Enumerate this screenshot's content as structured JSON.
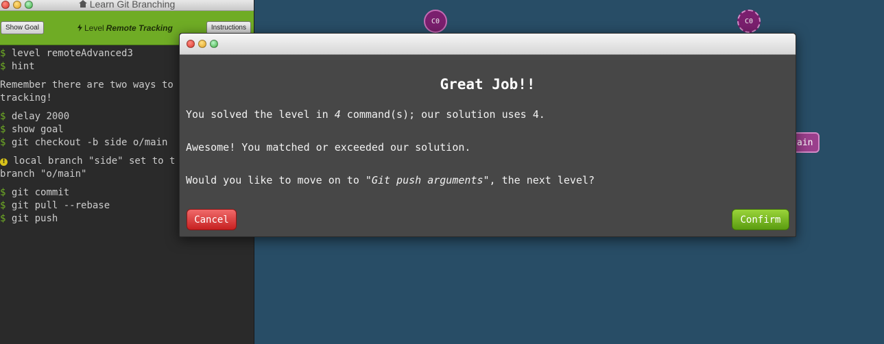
{
  "viz": {
    "commit_left": "C0",
    "commit_right": "C0",
    "branch_partial": "ain"
  },
  "terminal": {
    "window_title": "Learn Git Branching",
    "show_goal_label": "Show Goal",
    "level_prefix": "Level",
    "level_name": "Remote Tracking",
    "instructions_label": "Instructions",
    "lines": [
      {
        "prompt": "$",
        "text": " level remoteAdvanced3"
      },
      {
        "prompt": "$",
        "text": " hint"
      },
      {
        "prompt": "",
        "text": "Remember there are two ways to"
      },
      {
        "prompt": "",
        "text": "tracking!"
      },
      {
        "prompt": "$",
        "text": " delay 2000"
      },
      {
        "prompt": "$",
        "text": " show goal"
      },
      {
        "prompt": "$",
        "text": " git checkout -b side o/main"
      },
      {
        "prompt": "",
        "text": " local branch \"side\" set to t"
      },
      {
        "prompt": "",
        "text": "branch \"o/main\""
      },
      {
        "prompt": "$",
        "text": " git commit"
      },
      {
        "prompt": "$",
        "text": " git pull --rebase"
      },
      {
        "prompt": "$",
        "text": " git push"
      }
    ]
  },
  "modal": {
    "heading": "Great Job!!",
    "p1_before": "You solved the level in ",
    "p1_count": "4",
    "p1_after": " command(s); our solution uses 4.",
    "p2": "Awesome! You matched or exceeded our solution.",
    "p3_before": "Would you like to move on to ",
    "p3_level": "\"Git push arguments\"",
    "p3_after": ", the next level?",
    "cancel_label": "Cancel",
    "confirm_label": "Confirm"
  },
  "colors": {
    "toolbar_green": "#6fac25",
    "prompt_green": "#6fac25",
    "cancel_red": "#c62020",
    "confirm_green": "#5a9c10",
    "viz_bg": "#284d66"
  }
}
